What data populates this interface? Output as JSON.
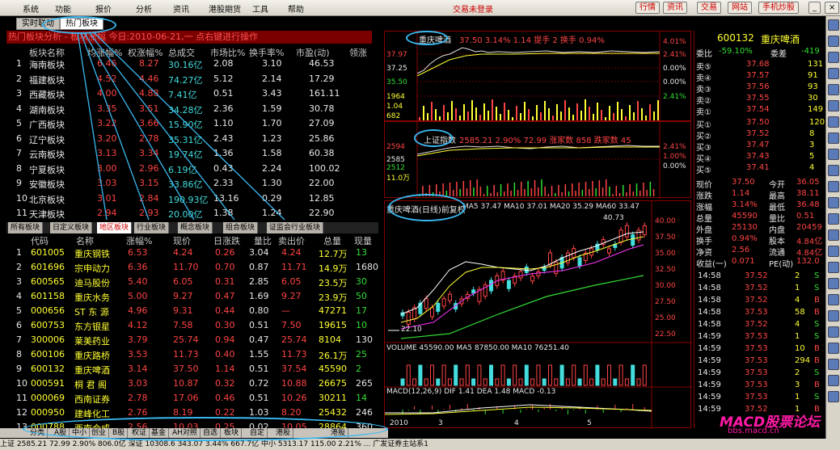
{
  "menu": {
    "items": [
      "系统",
      "功能",
      "报价",
      "分析",
      "资讯",
      "港股期货",
      "工具",
      "帮助"
    ],
    "title": "交易未登录",
    "buttons": [
      "行情",
      "资讯",
      "交易",
      "网站",
      "手机炒股"
    ]
  },
  "hot": {
    "tabs": [
      "实时联动",
      "热门板块"
    ],
    "title": "热门板块分析 - 板块涨幅 今日:2010-06-21,一 点右键进行操作",
    "headers": [
      "板块名称",
      "均涨幅%",
      "权涨幅%",
      "总成交",
      "市场比%",
      "换手率%",
      "市盈(动)",
      "领涨"
    ],
    "rows": [
      {
        "n": "1",
        "name": "海南板块",
        "a": "6.46",
        "b": "8.27",
        "c": "30.16亿",
        "d": "2.08",
        "e": "3.10",
        "f": "46.53"
      },
      {
        "n": "2",
        "name": "福建板块",
        "a": "4.52",
        "b": "4.46",
        "c": "74.27亿",
        "d": "5.12",
        "e": "2.14",
        "f": "17.29"
      },
      {
        "n": "3",
        "name": "西藏板块",
        "a": "4.00",
        "b": "4.88",
        "c": "7.41亿",
        "d": "0.51",
        "e": "3.43",
        "f": "161.11"
      },
      {
        "n": "4",
        "name": "湖南板块",
        "a": "3.35",
        "b": "3.51",
        "c": "34.28亿",
        "d": "2.36",
        "e": "1.59",
        "f": "30.78"
      },
      {
        "n": "5",
        "name": "广西板块",
        "a": "3.22",
        "b": "3.66",
        "c": "15.90亿",
        "d": "1.10",
        "e": "1.70",
        "f": "27.09"
      },
      {
        "n": "6",
        "name": "辽宁板块",
        "a": "3.20",
        "b": "2.78",
        "c": "35.31亿",
        "d": "2.43",
        "e": "1.23",
        "f": "25.86"
      },
      {
        "n": "7",
        "name": "云南板块",
        "a": "3.13",
        "b": "3.34",
        "c": "19.74亿",
        "d": "1.36",
        "e": "1.58",
        "f": "60.38"
      },
      {
        "n": "8",
        "name": "宁夏板块",
        "a": "3.00",
        "b": "2.96",
        "c": "6.19亿",
        "d": "0.43",
        "e": "2.24",
        "f": "100.02"
      },
      {
        "n": "9",
        "name": "安徽板块",
        "a": "3.03",
        "b": "3.15",
        "c": "33.86亿",
        "d": "2.33",
        "e": "1.30",
        "f": "22.00"
      },
      {
        "n": "10",
        "name": "北京板块",
        "a": "3.01",
        "b": "2.84",
        "c": "190.93亿",
        "d": "13.16",
        "e": "0.29",
        "f": "12.85"
      },
      {
        "n": "11",
        "name": "天津板块",
        "a": "2.94",
        "b": "2.93",
        "c": "20.00亿",
        "d": "1.38",
        "e": "1.24",
        "f": "22.90"
      }
    ]
  },
  "sector_tabs": [
    "所有板块",
    "日定义板块",
    "地区板块",
    "行业板块",
    "概念板块",
    "组合板块",
    "证监会行业板块"
  ],
  "list": {
    "headers": [
      "代码",
      "名称",
      "涨幅%",
      "现价",
      "日涨跌",
      "量比",
      "卖出价",
      "总量",
      "现量"
    ],
    "rows": [
      {
        "n": "1",
        "code": "601005",
        "name": "重庆钢铁",
        "pct": "6.53",
        "price": "4.24",
        "chg": "0.26",
        "vr": "3.04",
        "ask": "4.24",
        "vol": "12.7万",
        "cur": "13"
      },
      {
        "n": "2",
        "code": "601696",
        "name": "宗申动力",
        "pct": "6.36",
        "price": "11.70",
        "chg": "0.70",
        "vr": "0.87",
        "ask": "11.71",
        "vol": "14.9万",
        "cur": "1680"
      },
      {
        "n": "3",
        "code": "600565",
        "name": "迪马股份",
        "pct": "5.40",
        "price": "6.05",
        "chg": "0.31",
        "vr": "2.85",
        "ask": "6.05",
        "vol": "23.5万",
        "cur": "30"
      },
      {
        "n": "4",
        "code": "601158",
        "name": "重庆水务",
        "pct": "5.00",
        "price": "9.27",
        "chg": "0.47",
        "vr": "1.69",
        "ask": "9.27",
        "vol": "23.9万",
        "cur": "50"
      },
      {
        "n": "5",
        "code": "000656",
        "name": "ST 东 源",
        "pct": "4.96",
        "price": "9.31",
        "chg": "0.44",
        "vr": "0.80",
        "ask": "—",
        "vol": "47271",
        "cur": "17"
      },
      {
        "n": "6",
        "code": "600753",
        "name": "东方银星",
        "pct": "4.12",
        "price": "7.58",
        "chg": "0.30",
        "vr": "0.51",
        "ask": "7.50",
        "vol": "19615",
        "cur": "10"
      },
      {
        "n": "7",
        "code": "300006",
        "name": "莱美药业",
        "pct": "3.79",
        "price": "25.74",
        "chg": "0.94",
        "vr": "0.47",
        "ask": "25.74",
        "vol": "8104",
        "cur": "130"
      },
      {
        "n": "8",
        "code": "600106",
        "name": "重庆路桥",
        "pct": "3.53",
        "price": "11.73",
        "chg": "0.40",
        "vr": "1.55",
        "ask": "11.73",
        "vol": "26.1万",
        "cur": "25"
      },
      {
        "n": "9",
        "code": "600132",
        "name": "重庆啤酒",
        "pct": "3.14",
        "price": "37.50",
        "chg": "1.14",
        "vr": "0.51",
        "ask": "37.54",
        "vol": "45590",
        "cur": "2"
      },
      {
        "n": "10",
        "code": "000591",
        "name": "桐 君 阁",
        "pct": "3.03",
        "price": "10.87",
        "chg": "0.32",
        "vr": "0.72",
        "ask": "10.88",
        "vol": "26675",
        "cur": "265"
      },
      {
        "n": "11",
        "code": "000069",
        "name": "西南证券",
        "pct": "2.78",
        "price": "17.06",
        "chg": "0.46",
        "vr": "0.51",
        "ask": "10.26",
        "vol": "30211",
        "cur": "14"
      },
      {
        "n": "12",
        "code": "000950",
        "name": "建峰化工",
        "pct": "2.76",
        "price": "8.19",
        "chg": "0.22",
        "vr": "1.03",
        "ask": "8.20",
        "vol": "25432",
        "cur": "246"
      },
      {
        "n": "13",
        "code": "000788",
        "name": "西南合成",
        "pct": "2.56",
        "price": "10.03",
        "chg": "0.25",
        "vr": "0.02",
        "ask": "10.05",
        "vol": "28864",
        "cur": "360"
      }
    ]
  },
  "bottom_tabs": [
    "分类",
    "A股",
    "中小",
    "创业",
    "B股",
    "权证",
    "基金",
    "AH对照",
    "自选",
    "板块",
    "自定",
    "港股",
    "港股"
  ],
  "status": "上证 2585.21  72.99  2.90%  806.0亿 深证 10308.6  343.07  3.44%  667.7亿 中小 5313.17  115.00  2.21%  ...  广发证券主站系1",
  "mini": {
    "label": "重庆啤酒",
    "info": "37.50 3.14% 1.14 提手 2 换手 0.94%",
    "yl": [
      "37.97",
      "37.25",
      "35.50",
      "1964",
      "1.04",
      "682"
    ],
    "yr": [
      "4.01%",
      "2.41%",
      "0.00%",
      "0.00%",
      "2.41%",
      "0.00%"
    ]
  },
  "idx": {
    "label": "上证指数",
    "info": "2585.21 2.90% 72.99 涨家数 858 跌家数 45",
    "yl": [
      "2594",
      "2585",
      "2512",
      "11.0万"
    ],
    "yr": [
      "2.41%",
      "1.00%",
      "0.00%",
      "0.00%"
    ]
  },
  "k": {
    "label": "重庆啤酒(日线)前复权",
    "ma": "MA5 37.47  MA10 37.01  MA20 35.29  MA60 33.47",
    "high": "40.73",
    "low": "22.10",
    "yr": [
      "40.00",
      "37.50",
      "35.00",
      "32.50",
      "30.00",
      "27.50",
      "25.00",
      "22.50"
    ],
    "vol": "VOLUME 45590.00  MA5 87850.00  MA10 76251.40",
    "macd": "MACD(12,26,9) DIF 1.41  DEA 1.48  MACD -0.13",
    "dates": [
      "2010",
      "3",
      "4",
      "5"
    ]
  },
  "quote": {
    "code": "600132",
    "name": "重庆啤酒",
    "ratio_label": "委比",
    "ratio": "-59.10%",
    "diff_label": "委差",
    "diff": "-419",
    "sells": [
      {
        "l": "卖⑤",
        "p": "37.68",
        "v": "131"
      },
      {
        "l": "卖④",
        "p": "37.57",
        "v": "91"
      },
      {
        "l": "卖③",
        "p": "37.56",
        "v": "93"
      },
      {
        "l": "卖②",
        "p": "37.55",
        "v": "30"
      },
      {
        "l": "卖①",
        "p": "37.54",
        "v": "149"
      }
    ],
    "buys": [
      {
        "l": "买①",
        "p": "37.50",
        "v": "120"
      },
      {
        "l": "买②",
        "p": "37.52",
        "v": "8"
      },
      {
        "l": "买③",
        "p": "37.47",
        "v": "3"
      },
      {
        "l": "买④",
        "p": "37.43",
        "v": "5"
      },
      {
        "l": "买⑤",
        "p": "37.41",
        "v": "4"
      }
    ],
    "stats": [
      {
        "a": "现价",
        "b": "37.50",
        "c": "今开",
        "d": "36.05"
      },
      {
        "a": "涨跌",
        "b": "1.14",
        "c": "最高",
        "d": "38.11"
      },
      {
        "a": "涨幅",
        "b": "3.14%",
        "c": "最低",
        "d": "36.48"
      },
      {
        "a": "总量",
        "b": "45590",
        "c": "量比",
        "d": "0.51"
      },
      {
        "a": "外盘",
        "b": "25130",
        "c": "内盘",
        "d": "20459"
      },
      {
        "a": "换手",
        "b": "0.94%",
        "c": "股本",
        "d": "4.84亿"
      },
      {
        "a": "净资",
        "b": "2.56",
        "c": "流通",
        "d": "4.84亿"
      },
      {
        "a": "收益(一)",
        "b": "0.071",
        "c": "PE(动)",
        "d": "132.0"
      }
    ],
    "ticks": [
      {
        "t": "14:58",
        "p": "37.52",
        "v": "2",
        "s": "S"
      },
      {
        "t": "14:58",
        "p": "37.52",
        "v": "1",
        "s": "S"
      },
      {
        "t": "14:58",
        "p": "37.52",
        "v": "4",
        "s": "B"
      },
      {
        "t": "14:58",
        "p": "37.53",
        "v": "58",
        "s": "B"
      },
      {
        "t": "14:58",
        "p": "37.52",
        "v": "4",
        "s": "S"
      },
      {
        "t": "14:59",
        "p": "37.53",
        "v": "1",
        "s": "S"
      },
      {
        "t": "14:59",
        "p": "37.53",
        "v": "10",
        "s": "B"
      },
      {
        "t": "14:59",
        "p": "37.53",
        "v": "294",
        "s": "B"
      },
      {
        "t": "14:59",
        "p": "37.53",
        "v": "2",
        "s": "S"
      },
      {
        "t": "14:59",
        "p": "37.53",
        "v": "3",
        "s": "B"
      },
      {
        "t": "14:59",
        "p": "37.53",
        "v": "1",
        "s": "S"
      },
      {
        "t": "14:59",
        "p": "37.52",
        "v": "1",
        "s": "B"
      }
    ]
  },
  "watermark": {
    "main": "MACD股票论坛",
    "sub": "bbs.macd.cn"
  },
  "colors": {
    "up": "#ff4444",
    "down": "#33dd33",
    "frame": "#880000",
    "annot": "#3ab8f0"
  }
}
